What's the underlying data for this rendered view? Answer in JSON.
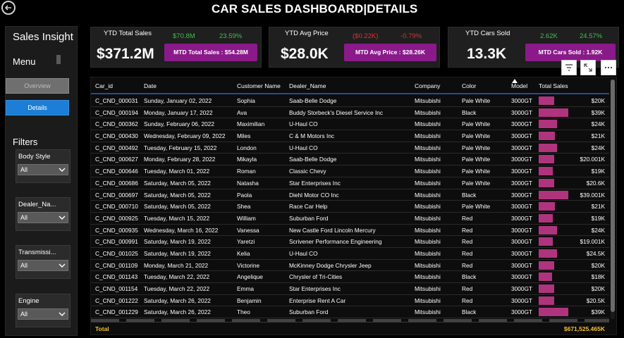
{
  "title": "CAR SALES DASHBOARD|DETAILS",
  "sidebar": {
    "title": "Sales Insight",
    "menu": "Menu",
    "overview_btn": "Overview",
    "details_btn": "Details",
    "filters": "Filters",
    "filter_items": [
      {
        "label": "Body Style",
        "value": "All"
      },
      {
        "label": "Dealer_Na...",
        "value": "All"
      },
      {
        "label": "Transmissi...",
        "value": "All"
      },
      {
        "label": "Engine",
        "value": "All"
      }
    ]
  },
  "kpis": [
    {
      "label": "YTD Total Sales",
      "value": "$371.2M",
      "a": "$70.8M",
      "b": "23.59%",
      "a_color": "#3fbf4f",
      "b_color": "#3fbf4f",
      "mtd": "MTD Total Sales : $54.28M"
    },
    {
      "label": "YTD Avg Price",
      "value": "$28.0K",
      "a": "($0.22K)",
      "b": "-0.79%",
      "a_color": "#e03030",
      "b_color": "#e03030",
      "mtd": "MTD Avg Price : $28.26K"
    },
    {
      "label": "YTD Cars Sold",
      "value": "13.3K",
      "a": "2.62K",
      "b": "24.57%",
      "a_color": "#3fbf4f",
      "b_color": "#3fbf4f",
      "mtd": "MTD Cars Sold : 1.92K"
    }
  ],
  "toolbar": {
    "filter_icon": "filter-icon",
    "expand_icon": "focus-mode-icon",
    "more_icon": "more-options-icon"
  },
  "table": {
    "headers": [
      "Car_id",
      "Date",
      "Customer Name",
      "Dealer_Name",
      "Company",
      "Color",
      "Model",
      "Total Sales"
    ],
    "rows": [
      [
        "C_CND_000031",
        "Sunday, January 02, 2022",
        "Sophia",
        "Saab-Belle Dodge",
        "Mitsubishi",
        "Pale White",
        "3000GT",
        "$20K",
        20
      ],
      [
        "C_CND_000194",
        "Monday, January 17, 2022",
        "Ava",
        "Buddy Storbeck's Diesel Service Inc",
        "Mitsubishi",
        "Black",
        "3000GT",
        "$39K",
        39
      ],
      [
        "C_CND_000362",
        "Sunday, February 06, 2022",
        "Maximilian",
        "U-Haul CO",
        "Mitsubishi",
        "Pale White",
        "3000GT",
        "$24K",
        24
      ],
      [
        "C_CND_000430",
        "Wednesday, February 09, 2022",
        "Miles",
        "C & M Motors Inc",
        "Mitsubishi",
        "Pale White",
        "3000GT",
        "$21K",
        21
      ],
      [
        "C_CND_000492",
        "Tuesday, February 15, 2022",
        "London",
        "U-Haul CO",
        "Mitsubishi",
        "Pale White",
        "3000GT",
        "$24K",
        24
      ],
      [
        "C_CND_000627",
        "Monday, February 28, 2022",
        "Mikayla",
        "Saab-Belle Dodge",
        "Mitsubishi",
        "Pale White",
        "3000GT",
        "$20.001K",
        20.001
      ],
      [
        "C_CND_000646",
        "Tuesday, March 01, 2022",
        "Roman",
        "Classic Chevy",
        "Mitsubishi",
        "Pale White",
        "3000GT",
        "$19K",
        19
      ],
      [
        "C_CND_000686",
        "Saturday, March 05, 2022",
        "Natasha",
        "Star Enterprises Inc",
        "Mitsubishi",
        "Pale White",
        "3000GT",
        "$20.6K",
        20.6
      ],
      [
        "C_CND_000697",
        "Saturday, March 05, 2022",
        "Paola",
        "Diehl Motor CO Inc",
        "Mitsubishi",
        "Black",
        "3000GT",
        "$39.001K",
        39.001
      ],
      [
        "C_CND_000710",
        "Saturday, March 05, 2022",
        "Shea",
        "Race Car Help",
        "Mitsubishi",
        "Pale White",
        "3000GT",
        "$21K",
        21
      ],
      [
        "C_CND_000925",
        "Tuesday, March 15, 2022",
        "William",
        "Suburban Ford",
        "Mitsubishi",
        "Red",
        "3000GT",
        "$19K",
        19
      ],
      [
        "C_CND_000935",
        "Wednesday, March 16, 2022",
        "Vanessa",
        "New Castle Ford Lincoln Mercury",
        "Mitsubishi",
        "Red",
        "3000GT",
        "$24K",
        24
      ],
      [
        "C_CND_000991",
        "Saturday, March 19, 2022",
        "Yaretzi",
        "Scrivener Performance Engineering",
        "Mitsubishi",
        "Red",
        "3000GT",
        "$19.001K",
        19.001
      ],
      [
        "C_CND_001025",
        "Saturday, March 19, 2022",
        "Kelia",
        "U-Haul CO",
        "Mitsubishi",
        "Red",
        "3000GT",
        "$24.5K",
        24.5
      ],
      [
        "C_CND_001109",
        "Monday, March 21, 2022",
        "Victorine",
        "McKinney Dodge Chrysler Jeep",
        "Mitsubishi",
        "Red",
        "3000GT",
        "$20K",
        20
      ],
      [
        "C_CND_001143",
        "Tuesday, March 22, 2022",
        "Angelique",
        "Chrysler of Tri-Cities",
        "Mitsubishi",
        "Black",
        "3000GT",
        "$18K",
        18
      ],
      [
        "C_CND_001154",
        "Tuesday, March 22, 2022",
        "Emma",
        "Star Enterprises Inc",
        "Mitsubishi",
        "Red",
        "3000GT",
        "$20K",
        20
      ],
      [
        "C_CND_001222",
        "Saturday, March 26, 2022",
        "Benjamin",
        "Enterprise Rent A Car",
        "Mitsubishi",
        "Red",
        "3000GT",
        "$20.5K",
        20.5
      ],
      [
        "C_CND_001229",
        "Saturday, March 26, 2022",
        "Theo",
        "Suburban Ford",
        "Mitsubishi",
        "Black",
        "3000GT",
        "$39K",
        39
      ]
    ],
    "total_label": "Total",
    "total_value": "$671,525.465K"
  },
  "colors": {
    "accent": "#1c7ed6",
    "mtd": "#8a1a8a",
    "bar": "#b0347d",
    "total": "#f2c230"
  }
}
